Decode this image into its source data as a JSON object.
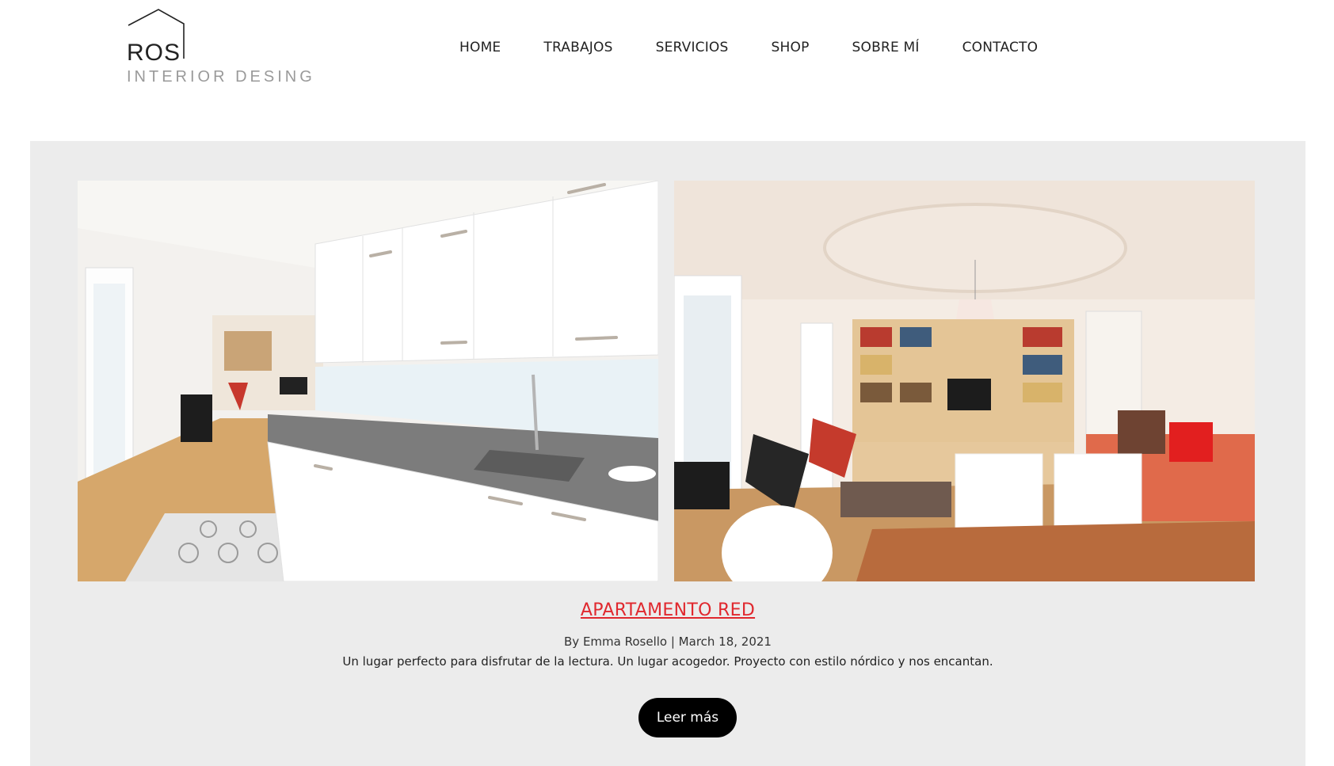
{
  "logo": {
    "name": "ROS",
    "tagline": "INTERIOR DESING"
  },
  "nav": {
    "items": [
      {
        "label": "HOME"
      },
      {
        "label": "TRABAJOS"
      },
      {
        "label": "SERVICIOS"
      },
      {
        "label": "SHOP"
      },
      {
        "label": "SOBRE MÍ"
      },
      {
        "label": "CONTACTO"
      }
    ]
  },
  "post": {
    "title": "APARTAMENTO RED",
    "meta": "By Emma Rosello | March 18, 2021",
    "excerpt": "Un lugar perfecto para disfrutar de la lectura. Un lugar acogedor. Proyecto con estilo nórdico y nos encantan.",
    "button_label": "Leer más",
    "images": [
      {
        "icon": "kitchen-photo"
      },
      {
        "icon": "living-room-photo"
      }
    ]
  },
  "colors": {
    "accent": "#e0282e",
    "panel_bg": "#ececec",
    "button_bg": "#000000"
  }
}
